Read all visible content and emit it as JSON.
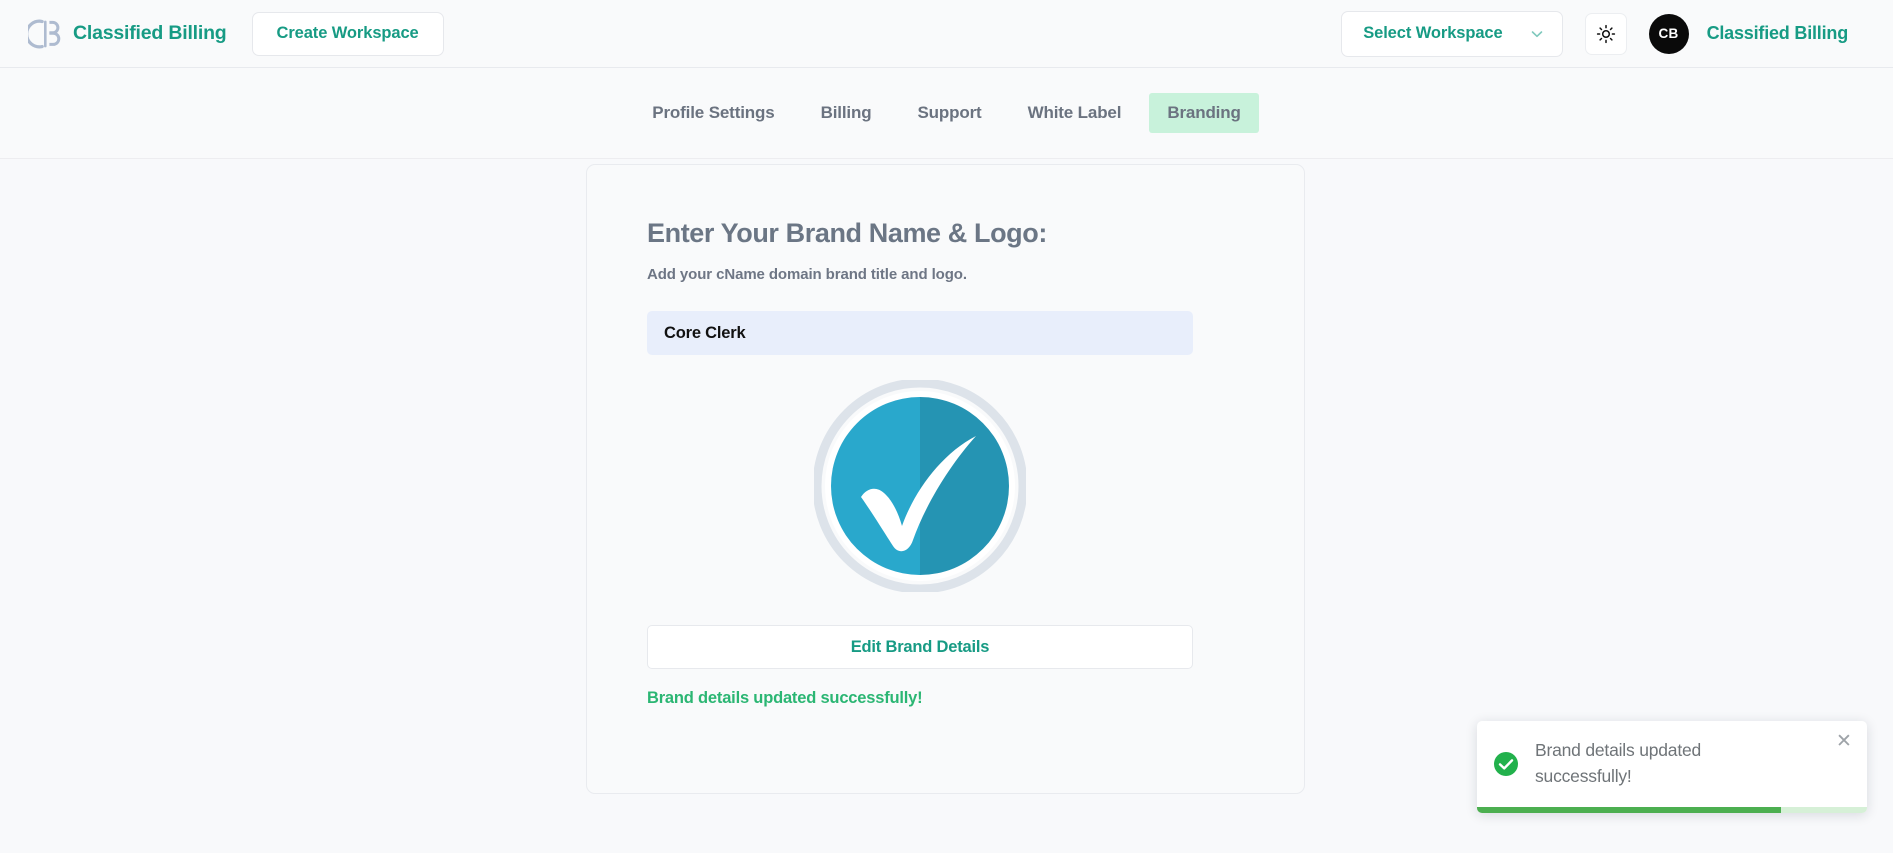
{
  "header": {
    "brand_name": "Classified Billing",
    "brand_logo_icon": "cb-monogram-logo-icon",
    "create_workspace_label": "Create Workspace",
    "workspace_select_label": "Select Workspace",
    "workspace_chevron_icon": "chevron-down-icon",
    "theme_toggle_icon": "sun-icon",
    "avatar_initials": "CB",
    "user_name": "Classified Billing"
  },
  "nav": {
    "tabs": [
      {
        "label": "Profile Settings",
        "active": false
      },
      {
        "label": "Billing",
        "active": false
      },
      {
        "label": "Support",
        "active": false
      },
      {
        "label": "White Label",
        "active": false
      },
      {
        "label": "Branding",
        "active": true
      }
    ]
  },
  "card": {
    "title": "Enter Your Brand Name & Logo:",
    "subtitle": "Add your cName domain brand title and logo.",
    "brand_name_value": "Core Clerk",
    "brand_name_placeholder": "Core Clerk",
    "logo_icon": "teal-circle-checkmark-logo-icon",
    "edit_button_label": "Edit Brand Details",
    "inline_success_message": "Brand details updated successfully!"
  },
  "toast": {
    "message": "Brand details updated successfully!",
    "status_icon": "green-check-circle-icon",
    "close_icon": "close-icon",
    "progress_percent": 78
  },
  "colors": {
    "brand_teal": "#179b84",
    "active_tab_bg": "#c8f2db",
    "success_green": "#2bb673",
    "toast_green": "#4caf50",
    "input_bg": "#e8eefb",
    "page_bg": "#f8f9fb",
    "logo_teal_light": "#29a8cc",
    "logo_teal_dark": "#2594b3"
  }
}
